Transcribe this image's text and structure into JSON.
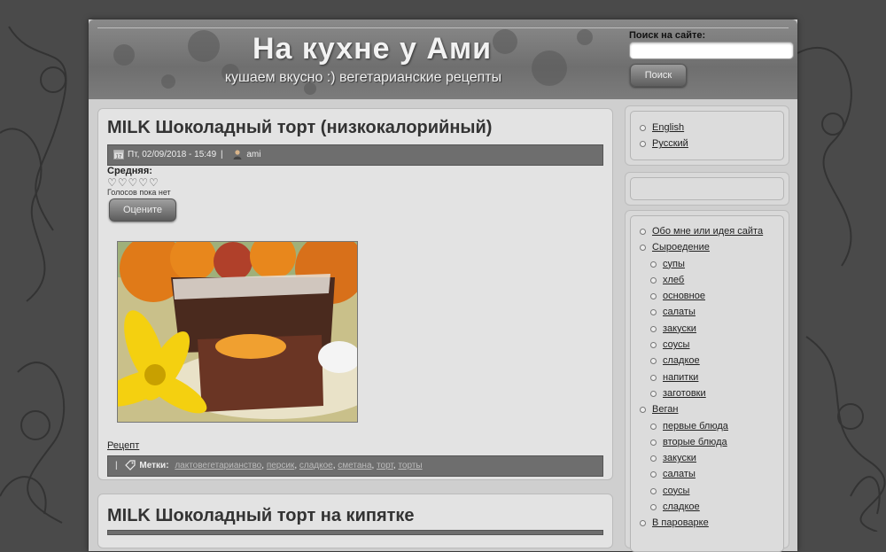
{
  "header": {
    "site_title": "На кухне у Ами",
    "site_slogan": "кушаем вкусно :) вегетарианские рецепты",
    "search_label": "Поиск на сайте:",
    "search_value": "",
    "search_button": "Поиск"
  },
  "article1": {
    "title": "MILK Шоколадный торт (низкокалорийный)",
    "date": "Пт, 02/09/2018 - 15:49",
    "separator": "|",
    "author": "ami",
    "rating_label": "Средняя:",
    "stars": "♡♡♡♡♡",
    "votes_text": "Голосов пока нет",
    "rate_button": "Оцените",
    "recipe_link": "Рецепт",
    "tags_separator": "|",
    "tags_label": "Метки:",
    "tags": [
      "лактовегетарианство",
      "персик",
      "сладкое",
      "сметана",
      "торт",
      "торты"
    ]
  },
  "article2": {
    "title": "MILK Шоколадный торт на кипятке"
  },
  "sidebar": {
    "languages": [
      "English",
      "Русский"
    ],
    "menu": [
      {
        "label": "Обо мне или идея сайта",
        "sub": false
      },
      {
        "label": "Сыроедение",
        "sub": false
      },
      {
        "label": "супы",
        "sub": true
      },
      {
        "label": "хлеб",
        "sub": true
      },
      {
        "label": "основное",
        "sub": true
      },
      {
        "label": "салаты",
        "sub": true
      },
      {
        "label": "закуски",
        "sub": true
      },
      {
        "label": "соусы",
        "sub": true
      },
      {
        "label": "сладкое",
        "sub": true
      },
      {
        "label": "напитки",
        "sub": true
      },
      {
        "label": "заготовки",
        "sub": true
      },
      {
        "label": "Веган",
        "sub": false
      },
      {
        "label": "первые блюда",
        "sub": true
      },
      {
        "label": "вторые блюда",
        "sub": true
      },
      {
        "label": "закуски",
        "sub": true
      },
      {
        "label": "салаты",
        "sub": true
      },
      {
        "label": "соусы",
        "sub": true
      },
      {
        "label": "сладкое",
        "sub": true
      },
      {
        "label": "В пароварке",
        "sub": false
      }
    ]
  }
}
